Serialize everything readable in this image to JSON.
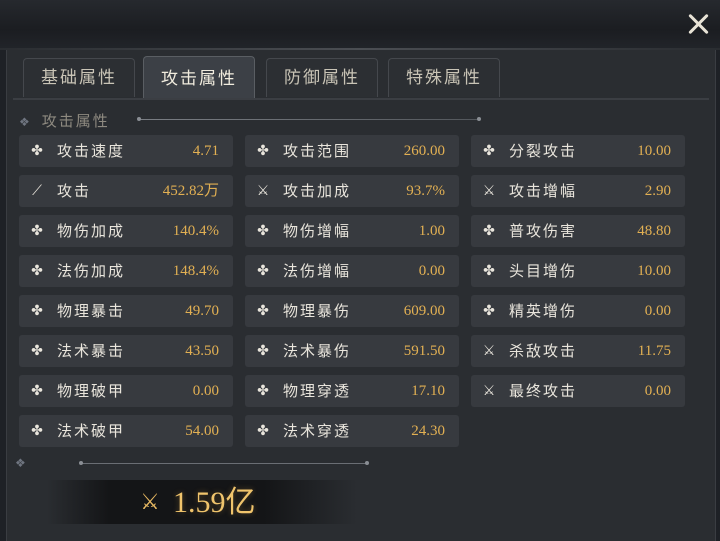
{
  "tabs": [
    {
      "label": "基础属性",
      "active": false
    },
    {
      "label": "攻击属性",
      "active": true
    },
    {
      "label": "防御属性",
      "active": false
    },
    {
      "label": "特殊属性",
      "active": false
    }
  ],
  "section_title": "攻击属性",
  "colors": {
    "value": "#e2b053",
    "label": "#e9e5dc",
    "row_bg": "#373a3f"
  },
  "stats": [
    [
      {
        "label": "攻击速度",
        "value": "4.71",
        "icon": "star-icon"
      },
      {
        "label": "攻击",
        "value": "452.82万",
        "icon": "blade-icon"
      },
      {
        "label": "物伤加成",
        "value": "140.4%",
        "icon": "star-icon"
      },
      {
        "label": "法伤加成",
        "value": "148.4%",
        "icon": "star-icon"
      },
      {
        "label": "物理暴击",
        "value": "49.70",
        "icon": "star-icon"
      },
      {
        "label": "法术暴击",
        "value": "43.50",
        "icon": "star-icon"
      },
      {
        "label": "物理破甲",
        "value": "0.00",
        "icon": "star-icon"
      },
      {
        "label": "法术破甲",
        "value": "54.00",
        "icon": "star-icon"
      }
    ],
    [
      {
        "label": "攻击范围",
        "value": "260.00",
        "icon": "star-icon"
      },
      {
        "label": "攻击加成",
        "value": "93.7%",
        "icon": "sword-icon"
      },
      {
        "label": "物伤增幅",
        "value": "1.00",
        "icon": "star-icon"
      },
      {
        "label": "法伤增幅",
        "value": "0.00",
        "icon": "star-icon"
      },
      {
        "label": "物理暴伤",
        "value": "609.00",
        "icon": "star-icon"
      },
      {
        "label": "法术暴伤",
        "value": "591.50",
        "icon": "star-icon"
      },
      {
        "label": "物理穿透",
        "value": "17.10",
        "icon": "star-icon"
      },
      {
        "label": "法术穿透",
        "value": "24.30",
        "icon": "star-icon"
      }
    ],
    [
      {
        "label": "分裂攻击",
        "value": "10.00",
        "icon": "star-icon"
      },
      {
        "label": "攻击增幅",
        "value": "2.90",
        "icon": "sword-icon"
      },
      {
        "label": "普攻伤害",
        "value": "48.80",
        "icon": "star-icon"
      },
      {
        "label": "头目增伤",
        "value": "10.00",
        "icon": "star-icon"
      },
      {
        "label": "精英增伤",
        "value": "0.00",
        "icon": "star-icon"
      },
      {
        "label": "杀敌攻击",
        "value": "11.75",
        "icon": "sword-icon"
      },
      {
        "label": "最终攻击",
        "value": "0.00",
        "icon": "sword-icon"
      }
    ]
  ],
  "combat_power": "1.59亿"
}
